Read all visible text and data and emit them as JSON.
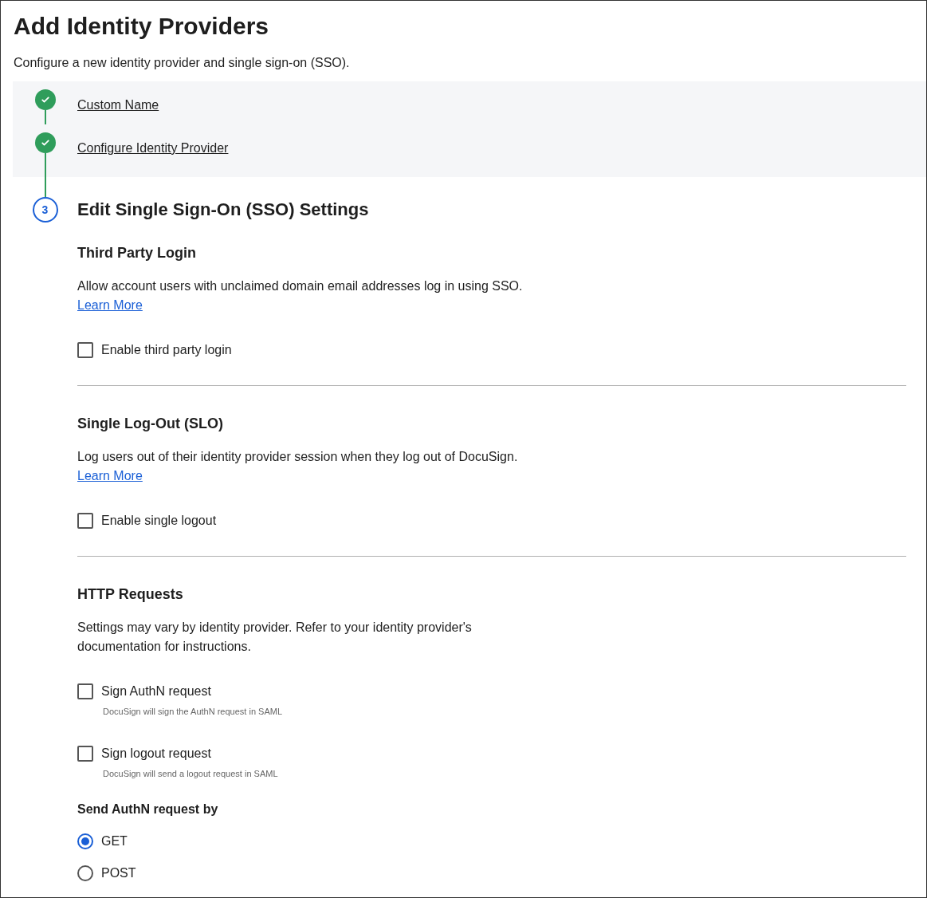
{
  "page": {
    "title": "Add Identity Providers",
    "subtitle": "Configure a new identity provider and single sign-on (SSO)."
  },
  "steps": [
    {
      "label": "Custom Name",
      "completed": true
    },
    {
      "label": "Configure Identity Provider",
      "completed": true
    },
    {
      "number": "3",
      "label": "Edit Single Sign-On (SSO) Settings",
      "completed": false
    }
  ],
  "sections": [
    {
      "title": "Third Party Login",
      "description": "Allow account users with unclaimed domain email addresses log in using SSO.",
      "link": "Learn More",
      "checkboxes": [
        {
          "label": "Enable third party login",
          "checked": false
        }
      ]
    },
    {
      "title": "Single Log-Out (SLO)",
      "description": "Log users out of their identity provider session when they log out of DocuSign.",
      "link": "Learn More",
      "checkboxes": [
        {
          "label": "Enable single logout",
          "checked": false
        }
      ]
    },
    {
      "title": "HTTP Requests",
      "description": "Settings may vary by identity provider. Refer to your identity provider's documentation for instructions.",
      "checkboxes": [
        {
          "label": "Sign AuthN request",
          "hint": "DocuSign will sign the AuthN request in SAML",
          "checked": false
        },
        {
          "label": "Sign logout request",
          "hint": "DocuSign will send a logout request in SAML",
          "checked": false
        }
      ],
      "radio_group": {
        "label": "Send AuthN request by",
        "options": [
          {
            "label": "GET",
            "selected": true
          },
          {
            "label": "POST",
            "selected": false
          }
        ]
      }
    }
  ]
}
